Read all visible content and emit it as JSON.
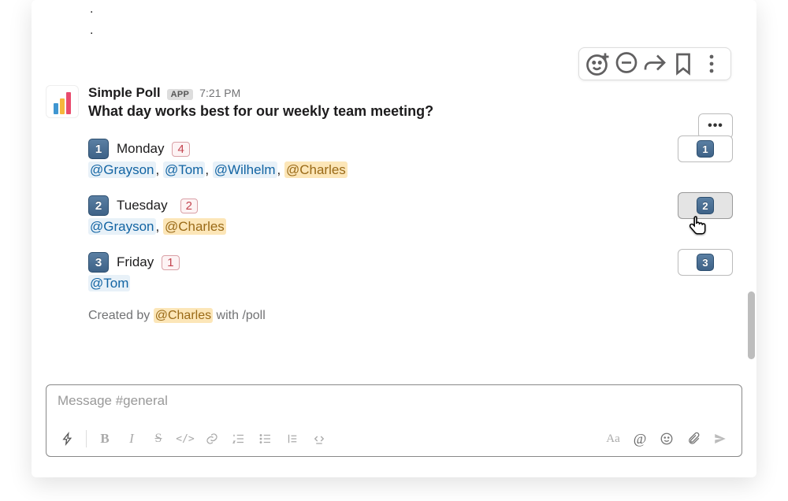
{
  "message": {
    "sender": "Simple Poll",
    "badge": "APP",
    "time": "7:21 PM",
    "question": "What day works best for our weekly team meeting?",
    "more_label": "•••",
    "created_by_prefix": "Created by ",
    "created_by_user": "@Charles",
    "created_by_suffix": " with ",
    "created_by_cmd": "/poll"
  },
  "options": [
    {
      "num": "1",
      "label": "Monday",
      "count": "4",
      "voters": [
        "@Grayson",
        "@Tom",
        "@Wilhelm",
        "@Charles"
      ],
      "self_voted": true
    },
    {
      "num": "2",
      "label": "Tuesday",
      "count": "2",
      "voters": [
        "@Grayson",
        "@Charles"
      ],
      "self_voted": true
    },
    {
      "num": "3",
      "label": "Friday",
      "count": "1",
      "voters": [
        "@Tom"
      ],
      "self_voted": false
    }
  ],
  "composer": {
    "placeholder": "Message #general"
  },
  "self_user": "@Charles"
}
